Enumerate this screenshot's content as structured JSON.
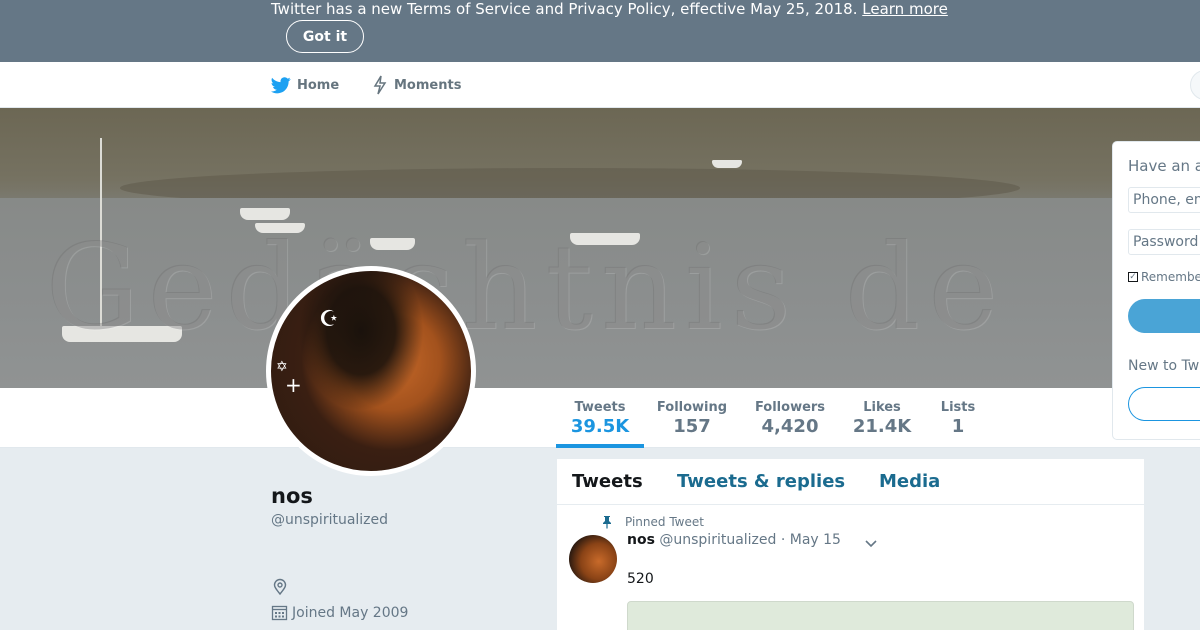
{
  "banner": {
    "text": "Twitter has a new Terms of Service and Privacy Policy, effective May 25, 2018.",
    "link_label": "Learn more",
    "button_label": "Got it"
  },
  "nav": {
    "home_label": "Home",
    "moments_label": "Moments"
  },
  "header": {
    "watermark_text": "Gedächtnis de"
  },
  "profile": {
    "name": "nos",
    "handle": "@unspiritualized",
    "joined": "Joined May 2009"
  },
  "stats": [
    {
      "label": "Tweets",
      "value": "39.5K"
    },
    {
      "label": "Following",
      "value": "157"
    },
    {
      "label": "Followers",
      "value": "4,420"
    },
    {
      "label": "Likes",
      "value": "21.4K"
    },
    {
      "label": "Lists",
      "value": "1"
    }
  ],
  "timeline": {
    "tabs": [
      "Tweets",
      "Tweets & replies",
      "Media"
    ],
    "pinned_label": "Pinned Tweet",
    "tweet": {
      "name": "nos",
      "handle": "@unspiritualized",
      "date": "· May 15",
      "text": "520"
    }
  },
  "login": {
    "title": "Have an ac",
    "phone_placeholder": "Phone, em",
    "password_placeholder": "Password",
    "remember_label": "Remembe",
    "new_label": "New to Twi"
  },
  "colors": {
    "banner_bg": "#657786",
    "accent": "#1b95e0",
    "tab_link": "#1b6b8f"
  }
}
